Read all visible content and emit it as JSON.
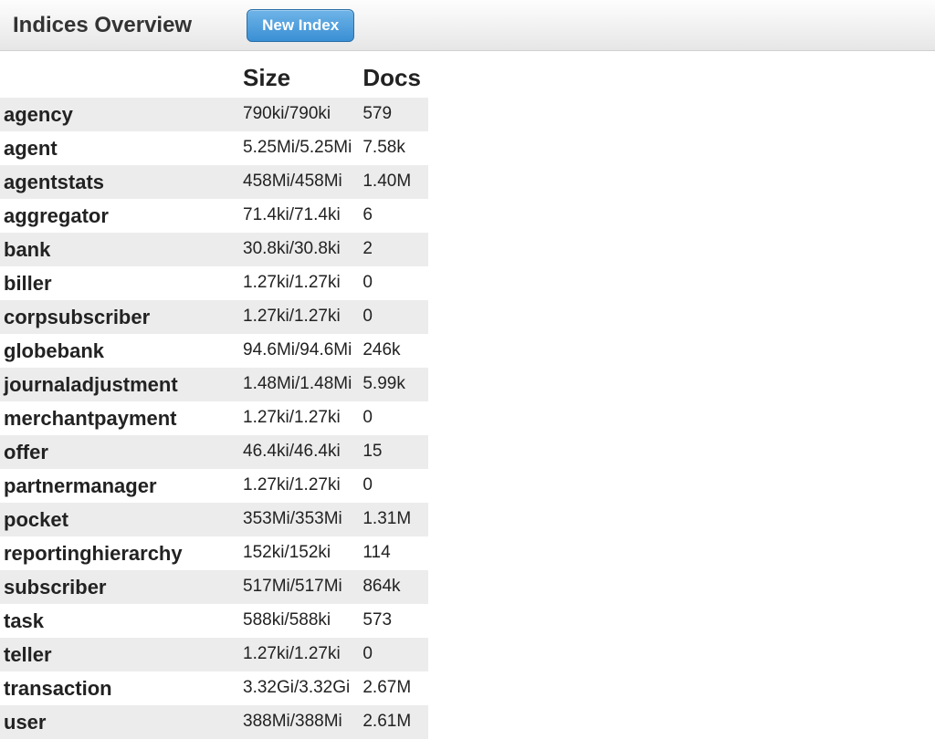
{
  "header": {
    "title": "Indices Overview",
    "newIndexLabel": "New Index"
  },
  "columns": {
    "name": "",
    "size": "Size",
    "docs": "Docs"
  },
  "rows": [
    {
      "name": "agency",
      "size": "790ki/790ki",
      "docs": "579"
    },
    {
      "name": "agent",
      "size": "5.25Mi/5.25Mi",
      "docs": "7.58k"
    },
    {
      "name": "agentstats",
      "size": "458Mi/458Mi",
      "docs": "1.40M"
    },
    {
      "name": "aggregator",
      "size": "71.4ki/71.4ki",
      "docs": "6"
    },
    {
      "name": "bank",
      "size": "30.8ki/30.8ki",
      "docs": "2"
    },
    {
      "name": "biller",
      "size": "1.27ki/1.27ki",
      "docs": "0"
    },
    {
      "name": "corpsubscriber",
      "size": "1.27ki/1.27ki",
      "docs": "0"
    },
    {
      "name": "globebank",
      "size": "94.6Mi/94.6Mi",
      "docs": "246k"
    },
    {
      "name": "journaladjustment",
      "size": "1.48Mi/1.48Mi",
      "docs": "5.99k"
    },
    {
      "name": "merchantpayment",
      "size": "1.27ki/1.27ki",
      "docs": "0"
    },
    {
      "name": "offer",
      "size": "46.4ki/46.4ki",
      "docs": "15"
    },
    {
      "name": "partnermanager",
      "size": "1.27ki/1.27ki",
      "docs": "0"
    },
    {
      "name": "pocket",
      "size": "353Mi/353Mi",
      "docs": "1.31M"
    },
    {
      "name": "reportinghierarchy",
      "size": "152ki/152ki",
      "docs": "114"
    },
    {
      "name": "subscriber",
      "size": "517Mi/517Mi",
      "docs": "864k"
    },
    {
      "name": "task",
      "size": "588ki/588ki",
      "docs": "573"
    },
    {
      "name": "teller",
      "size": "1.27ki/1.27ki",
      "docs": "0"
    },
    {
      "name": "transaction",
      "size": "3.32Gi/3.32Gi",
      "docs": "2.67M"
    },
    {
      "name": "user",
      "size": "388Mi/388Mi",
      "docs": "2.61M"
    }
  ]
}
